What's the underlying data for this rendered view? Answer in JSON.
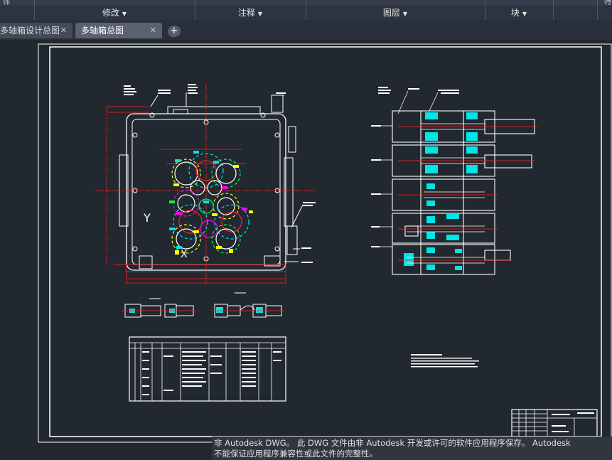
{
  "ribbon": {
    "panels": [
      {
        "label": "修改",
        "arrow": "▼"
      },
      {
        "label": "注释",
        "arrow": "▼"
      },
      {
        "label": "图层",
        "arrow": "▼"
      },
      {
        "label": "块",
        "arrow": "▼"
      }
    ],
    "partial_left": "饰",
    "partial_right": "特"
  },
  "tabs": [
    {
      "label": "多轴箱设计总图",
      "close": "✕",
      "active": false
    },
    {
      "label": "多轴箱总图",
      "close": "✕",
      "active": true
    }
  ],
  "add_tab": "+",
  "drawing": {
    "y_axis_label": "Y",
    "x_marker": "X"
  },
  "notice": {
    "line1": "非 Autodesk DWG。 此 DWG 文件由非 Autodesk 开发或许可的软件应用程序保存。 Autodesk",
    "line2": "不能保证应用程序兼容性或此文件的完整性。"
  },
  "colors": {
    "background": "#212830",
    "frame": "#ffffff",
    "centerline": "#ff2020",
    "cyan": "#00e5e5",
    "magenta": "#ff00ff",
    "yellow": "#ffff00",
    "green": "#00ff40"
  }
}
